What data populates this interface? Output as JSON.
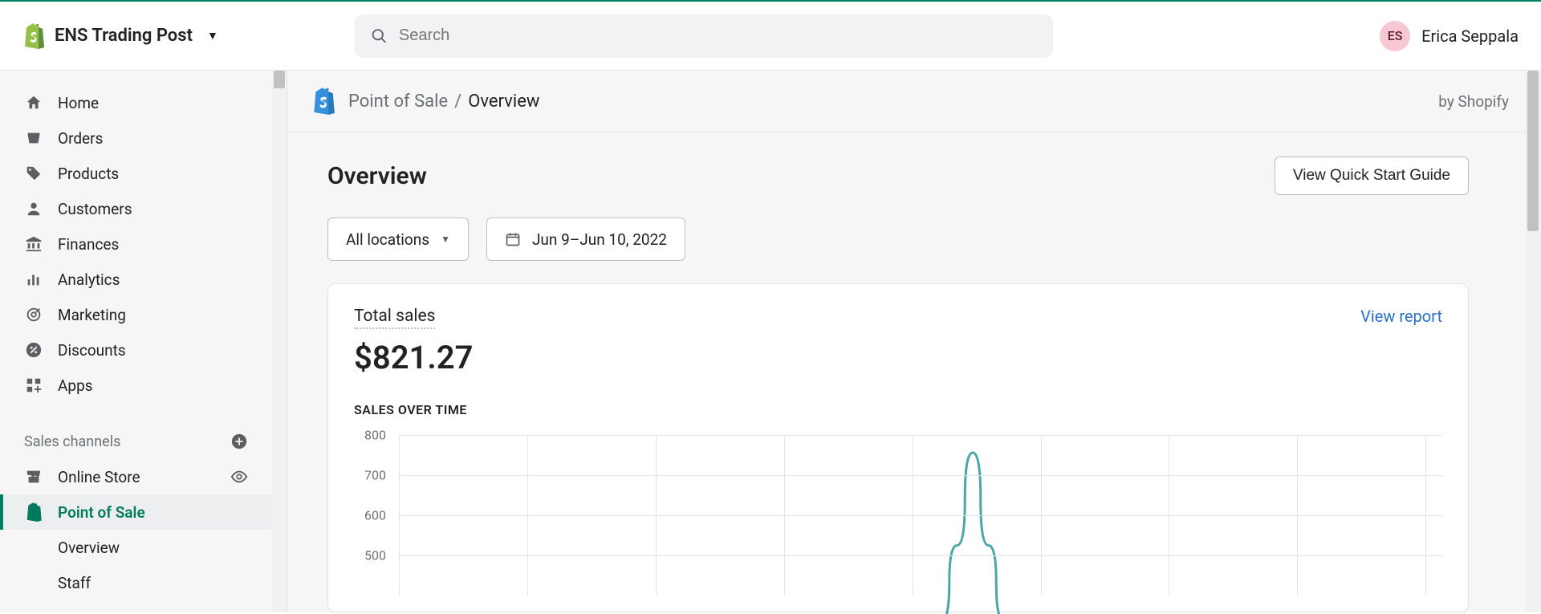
{
  "header": {
    "store_name": "ENS Trading Post",
    "search_placeholder": "Search",
    "user_initials": "ES",
    "user_name": "Erica Seppala"
  },
  "sidebar": {
    "items": [
      {
        "label": "Home"
      },
      {
        "label": "Orders"
      },
      {
        "label": "Products"
      },
      {
        "label": "Customers"
      },
      {
        "label": "Finances"
      },
      {
        "label": "Analytics"
      },
      {
        "label": "Marketing"
      },
      {
        "label": "Discounts"
      },
      {
        "label": "Apps"
      }
    ],
    "section_title": "Sales channels",
    "channels": [
      {
        "label": "Online Store"
      },
      {
        "label": "Point of Sale"
      }
    ],
    "pos_sub": [
      {
        "label": "Overview"
      },
      {
        "label": "Staff"
      }
    ]
  },
  "breadcrumb": {
    "a": "Point of Sale",
    "b": "Overview",
    "by": "by Shopify"
  },
  "page": {
    "title": "Overview",
    "quick_start": "View Quick Start Guide",
    "location_filter": "All locations",
    "date_filter": "Jun 9–Jun 10, 2022"
  },
  "card": {
    "metric_label": "Total sales",
    "metric_value": "$821.27",
    "view_report": "View report",
    "chart_title": "SALES OVER TIME"
  },
  "chart_data": {
    "type": "line",
    "title": "SALES OVER TIME",
    "xlabel": "",
    "ylabel": "",
    "ylim": [
      400,
      800
    ],
    "y_ticks": [
      800,
      700,
      600,
      500
    ],
    "series": [
      {
        "name": "Sales",
        "color": "#4aa8a3",
        "x_rel_pct": [
          52,
          53.5,
          55,
          56.5,
          58
        ],
        "values": [
          380,
          550,
          760,
          550,
          380
        ]
      }
    ],
    "grid_v_rel_pct": [
      0,
      12.3,
      24.6,
      36.9,
      49.2,
      61.5,
      73.8,
      86.1,
      98.4
    ]
  }
}
